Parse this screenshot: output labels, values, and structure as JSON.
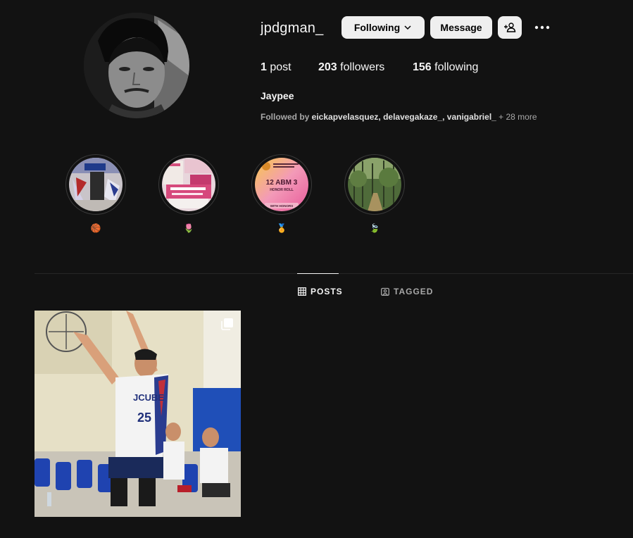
{
  "profile": {
    "username": "jpdgman_",
    "full_name": "Jaypee",
    "following_button": "Following",
    "message_button": "Message",
    "posts_count": "1",
    "posts_label": "post",
    "followers_count": "203",
    "followers_label": "followers",
    "following_count": "156",
    "following_label": "following",
    "followed_by_prefix": "Followed by ",
    "followed_by_names": "eickapvelasquez, delavegakaze_, vanigabriel_",
    "followed_by_more": " + 28 more"
  },
  "highlights": [
    {
      "label": "🏀",
      "icon": "basketball-court-photo"
    },
    {
      "label": "🌷",
      "icon": "campaign-posters-photo"
    },
    {
      "label": "🏅",
      "icon": "honor-roll-photo",
      "text_title": "12 ABM 3",
      "text_sub": "HONOR ROLL",
      "text_badge": "WITH HONORS"
    },
    {
      "label": "🍃",
      "icon": "forest-path-photo"
    }
  ],
  "tabs": {
    "posts": "POSTS",
    "tagged": "TAGGED"
  },
  "post": {
    "jersey_text": "JCUBE",
    "jersey_number": "25"
  },
  "colors": {
    "background": "#121212",
    "button_bg": "#efefef",
    "muted_text": "#a8a8a8",
    "divider": "#262626"
  }
}
